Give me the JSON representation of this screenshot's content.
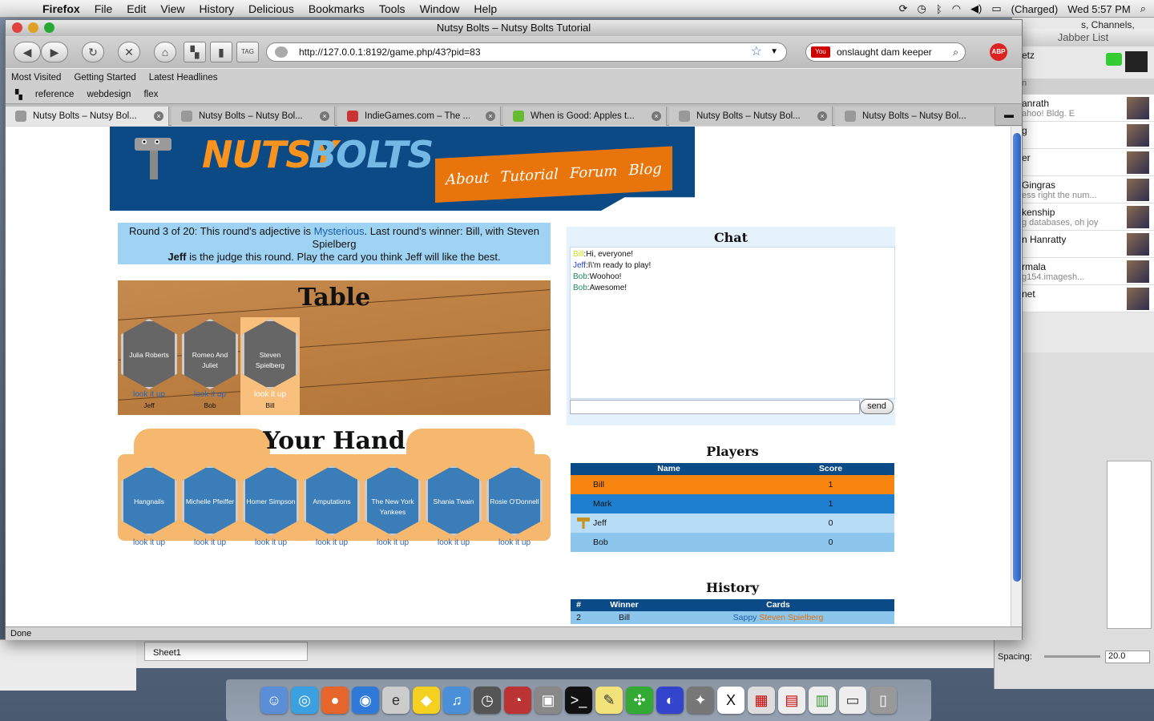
{
  "menubar": {
    "app": "Firefox",
    "items": [
      "File",
      "Edit",
      "View",
      "History",
      "Delicious",
      "Bookmarks",
      "Tools",
      "Window",
      "Help"
    ],
    "battery": "(Charged)",
    "clock": "Wed 5:57 PM"
  },
  "window": {
    "title": "Nutsy Bolts – Nutsy Bolts Tutorial",
    "url": "http://127.0.0.1:8192/game.php/43?pid=83",
    "search_value": "onslaught dam keeper",
    "status": "Done"
  },
  "bookmarks": {
    "row1": [
      "Most Visited",
      "Getting Started",
      "Latest Headlines"
    ],
    "row2": [
      "reference",
      "webdesign",
      "flex"
    ]
  },
  "tabs": [
    {
      "label": "Nutsy Bolts – Nutsy Bol..."
    },
    {
      "label": "Nutsy Bolts – Nutsy Bol..."
    },
    {
      "label": "IndieGames.com – The ..."
    },
    {
      "label": "When is Good: Apples t..."
    },
    {
      "label": "Nutsy Bolts – Nutsy Bol..."
    },
    {
      "label": "Nutsy Bolts – Nutsy Bol..."
    }
  ],
  "page": {
    "logo_left": "NUTSY",
    "logo_right": "BOLTS",
    "nav": [
      "About",
      "Tutorial",
      "Forum",
      "Blog"
    ],
    "round": {
      "line1_pre": "Round 3 of 20: This round's adjective is ",
      "adjective": "Mysterious",
      "line1_post": ". Last round's winner: Bill, with Steven Spielberg",
      "judge": "Jeff",
      "line2_post": " is the judge this round. Play the card you think Jeff will like the best."
    },
    "table_title": "Table",
    "table_cards": [
      {
        "name": "Julia Roberts",
        "lookup": "look it up",
        "owner": "Jeff"
      },
      {
        "name": "Romeo And Juliet",
        "lookup": "look it up",
        "owner": "Bob"
      },
      {
        "name": "Steven Spielberg",
        "lookup": "look it up",
        "owner": "Bill"
      }
    ],
    "hand_title": "Your Hand",
    "hand_cards": [
      {
        "name": "Hangnails",
        "lookup": "look it up"
      },
      {
        "name": "Michelle Pfeiffer",
        "lookup": "look it up"
      },
      {
        "name": "Homer Simpson",
        "lookup": "look it up"
      },
      {
        "name": "Amputations",
        "lookup": "look it up"
      },
      {
        "name": "The New York Yankees",
        "lookup": "look it up"
      },
      {
        "name": "Shania Twain",
        "lookup": "look it up"
      },
      {
        "name": "Rosie O'Donnell",
        "lookup": "look it up"
      }
    ],
    "chat_title": "Chat",
    "chat": [
      {
        "user": "Bill",
        "msg": "Hi, everyone!"
      },
      {
        "user": "Jeff",
        "msg": "I\\'m ready to play!"
      },
      {
        "user": "Bob",
        "msg": "Woohoo!"
      },
      {
        "user": "Bob",
        "msg": "Awesome!"
      }
    ],
    "send_label": "send",
    "players_title": "Players",
    "players_headers": [
      "Name",
      "Score"
    ],
    "players": [
      {
        "name": "Bill",
        "score": "1"
      },
      {
        "name": "Mark",
        "score": "1"
      },
      {
        "name": "Jeff",
        "score": "0"
      },
      {
        "name": "Bob",
        "score": "0"
      }
    ],
    "history_title": "History",
    "history_headers": [
      "#",
      "Winner",
      "Cards"
    ],
    "history": [
      {
        "num": "2",
        "winner": "Bill",
        "adj": "Sappy",
        "card": "Steven Spielberg"
      }
    ]
  },
  "jabber": {
    "title": "Jabber List",
    "top": "etz",
    "rows": [
      {
        "name": "anrath",
        "sub": "ahoo! Bldg. E"
      },
      {
        "name": "g",
        "sub": ""
      },
      {
        "name": "er",
        "sub": ""
      },
      {
        "name": "Gingras",
        "sub": "ess right the num..."
      },
      {
        "name": "kenship",
        "sub": "g databases, oh joy"
      },
      {
        "name": "n Hanratty",
        "sub": ""
      },
      {
        "name": "rmala",
        "sub": "g154.imagesh..."
      },
      {
        "name": "net",
        "sub": ""
      }
    ]
  },
  "background": {
    "channels": "s, Channels,",
    "sheet_tab": "Sheet1",
    "spacing_label": "Spacing:",
    "spacing_value": "20.0"
  }
}
